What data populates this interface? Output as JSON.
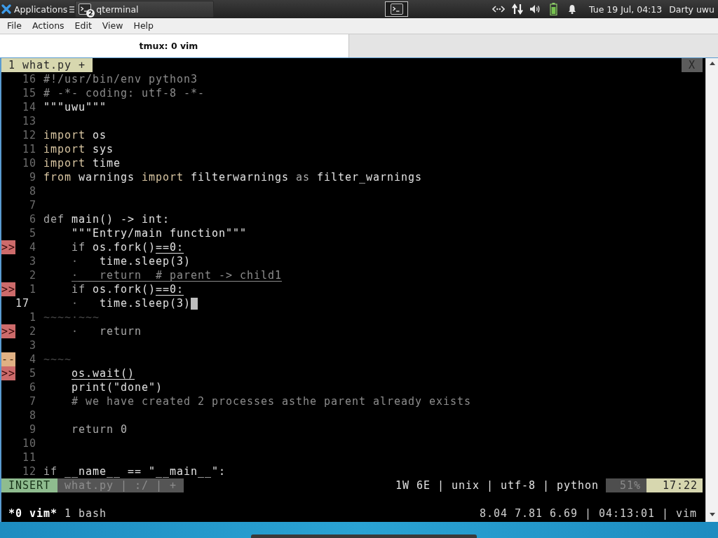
{
  "panel": {
    "apps_label": "Applications",
    "task": {
      "label": "qterminal",
      "badge": "2"
    },
    "clock": "Tue 19 Jul, 04:13",
    "user": "Darty uwu"
  },
  "menu": [
    "File",
    "Actions",
    "Edit",
    "View",
    "Help"
  ],
  "tabs": [
    {
      "label": "tmux: 0 vim",
      "selected": true
    }
  ],
  "vim": {
    "tabline": {
      "tabs": [
        {
          "label": "1 what.py +",
          "selected": true
        }
      ],
      "close": "X"
    },
    "lines": [
      {
        "number": "16",
        "current": false,
        "segments": [
          {
            "text": "#!/usr/bin/env python3",
            "kind": "comment"
          }
        ]
      },
      {
        "number": "15",
        "current": false,
        "segments": [
          {
            "text": "# -*- coding: utf-8 -*-",
            "kind": "comment"
          }
        ]
      },
      {
        "number": "14",
        "current": false,
        "segments": [
          {
            "text": "\"\"\"uwu\"\"\"",
            "kind": "string"
          }
        ]
      },
      {
        "number": "13",
        "current": false
      },
      {
        "number": "12",
        "current": false,
        "segments": [
          {
            "text": "import",
            "kind": "include"
          },
          {
            "text": " os",
            "kind": "plain"
          }
        ]
      },
      {
        "number": "11",
        "current": false,
        "segments": [
          {
            "text": "import",
            "kind": "include"
          },
          {
            "text": " sys",
            "kind": "plain"
          }
        ]
      },
      {
        "number": "10",
        "current": false,
        "segments": [
          {
            "text": "import",
            "kind": "include"
          },
          {
            "text": " time",
            "kind": "plain"
          }
        ]
      },
      {
        "number": "9",
        "current": false,
        "segments": [
          {
            "text": "from",
            "kind": "include"
          },
          {
            "text": " warnings ",
            "kind": "plain"
          },
          {
            "text": "import",
            "kind": "include"
          },
          {
            "text": " filterwarnings ",
            "kind": "plain"
          },
          {
            "text": "as",
            "kind": "keyword"
          },
          {
            "text": " filter_warnings",
            "kind": "plain"
          }
        ]
      },
      {
        "number": "8",
        "current": false
      },
      {
        "number": "7",
        "current": false
      },
      {
        "number": "6",
        "current": false,
        "segments": [
          {
            "text": "def",
            "kind": "keyword"
          },
          {
            "text": " main() -> int:",
            "kind": "plain"
          }
        ]
      },
      {
        "number": "5",
        "current": false,
        "segments": [
          {
            "text": "    \"\"\"Entry/main function\"\"\"",
            "kind": "string"
          }
        ]
      },
      {
        "number": "4",
        "current": false,
        "sign": {
          "text": ">>",
          "kind": "error"
        },
        "segments": [
          {
            "text": "    if",
            "kind": "keyword"
          },
          {
            "text": " os.fork()",
            "kind": "plain"
          },
          {
            "text": "==0:",
            "kind": "plain",
            "underline": true
          }
        ]
      },
      {
        "number": "3",
        "current": false,
        "segments": [
          {
            "text": "    ·",
            "kind": "guide"
          },
          {
            "text": "   time.sleep(3)",
            "kind": "plain"
          }
        ]
      },
      {
        "number": "2",
        "current": false,
        "segments": [
          {
            "text": "    ·",
            "kind": "guide",
            "underline": true
          },
          {
            "text": "   return  # parent -> child1",
            "kind": "comment",
            "underline": true
          }
        ]
      },
      {
        "number": "1",
        "current": false,
        "sign": {
          "text": ">>",
          "kind": "error"
        },
        "segments": [
          {
            "text": "    if",
            "kind": "keyword"
          },
          {
            "text": " os.fork()",
            "kind": "plain"
          },
          {
            "text": "==0:",
            "kind": "plain",
            "underline": true
          }
        ]
      },
      {
        "number": "17",
        "current": true,
        "segments": [
          {
            "text": "    ·",
            "kind": "guide"
          },
          {
            "text": "   time.sleep(3)",
            "kind": "plain"
          }
        ]
      },
      {
        "number": "1",
        "current": false,
        "segments": [
          {
            "text": "~~~~·~~~",
            "kind": "dim"
          }
        ]
      },
      {
        "number": "2",
        "current": false,
        "sign": {
          "text": ">>",
          "kind": "error"
        },
        "segments": [
          {
            "text": "    ·",
            "kind": "guide"
          },
          {
            "text": "   return",
            "kind": "keyword"
          }
        ]
      },
      {
        "number": "3",
        "current": false
      },
      {
        "number": "4",
        "current": false,
        "sign": {
          "text": "--",
          "kind": "warning"
        },
        "segments": [
          {
            "text": "~~~~",
            "kind": "dim"
          }
        ]
      },
      {
        "number": "5",
        "current": false,
        "sign": {
          "text": ">>",
          "kind": "error"
        },
        "segments": [
          {
            "text": "    os.wait()",
            "kind": "plain",
            "underline": true
          }
        ]
      },
      {
        "number": "6",
        "current": false,
        "segments": [
          {
            "text": "    print(\"done\")",
            "kind": "plain"
          }
        ]
      },
      {
        "number": "7",
        "current": false,
        "segments": [
          {
            "text": "    # we have created 2 processes asthe parent already exists",
            "kind": "comment"
          }
        ]
      },
      {
        "number": "8",
        "current": false
      },
      {
        "number": "9",
        "current": false,
        "segments": [
          {
            "text": "    return",
            "kind": "keyword"
          },
          {
            "text": " 0",
            "kind": "number"
          }
        ]
      },
      {
        "number": "10",
        "current": false
      },
      {
        "number": "11",
        "current": false
      },
      {
        "number": "12",
        "current": false,
        "segments": [
          {
            "text": "if",
            "kind": "keyword"
          },
          {
            "text": " __name__ == \"__main__\":",
            "kind": "plain"
          }
        ]
      }
    ],
    "statusline": {
      "mode": {
        "label": "INSERT",
        "kind": "insert"
      },
      "file": "what.py | :/ | +",
      "info": "1W 6E | unix | utf-8 | python",
      "percent": "51%",
      "position": "17:22"
    }
  },
  "tmux": {
    "windows": [
      {
        "label": "*0 vim*",
        "selected": true
      },
      {
        "label": "1 bash",
        "selected": false
      }
    ],
    "status_right": "8.04 7.81 6.69 | 04:13:01 | vim"
  }
}
